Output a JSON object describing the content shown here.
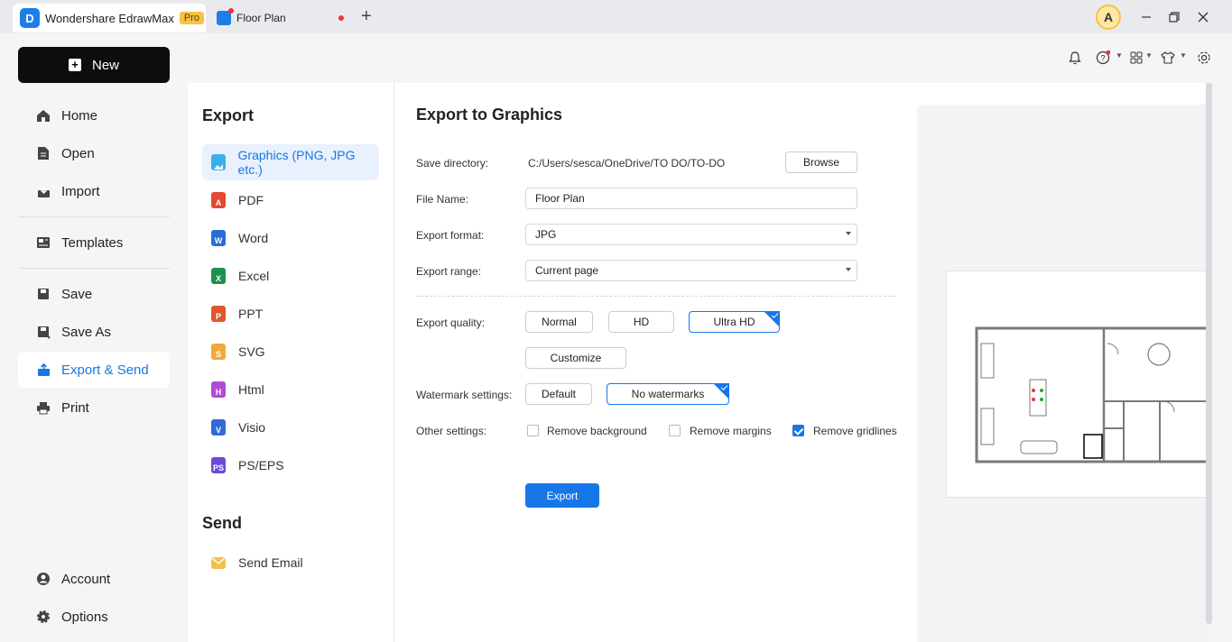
{
  "titlebar": {
    "app_name": "Wondershare EdrawMax",
    "pro_badge": "Pro",
    "doc_tab": "Floor Plan",
    "new_tab": "+",
    "avatar_letter": "A"
  },
  "sidebar": {
    "new_label": "New",
    "items": [
      {
        "label": "Home",
        "icon": "home-icon"
      },
      {
        "label": "Open",
        "icon": "open-icon"
      },
      {
        "label": "Import",
        "icon": "import-icon"
      },
      {
        "label": "Templates",
        "icon": "templates-icon"
      },
      {
        "label": "Save",
        "icon": "save-icon"
      },
      {
        "label": "Save As",
        "icon": "save-as-icon"
      },
      {
        "label": "Export & Send",
        "icon": "export-icon"
      },
      {
        "label": "Print",
        "icon": "print-icon"
      },
      {
        "label": "Account",
        "icon": "account-icon"
      },
      {
        "label": "Options",
        "icon": "options-icon"
      }
    ]
  },
  "export_list": {
    "title": "Export",
    "items": [
      {
        "label": "Graphics (PNG, JPG etc.)",
        "color": "#3ab0e8"
      },
      {
        "label": "PDF",
        "color": "#e5472f"
      },
      {
        "label": "Word",
        "color": "#2b6cd6"
      },
      {
        "label": "Excel",
        "color": "#1f8f4e"
      },
      {
        "label": "PPT",
        "color": "#e0572c"
      },
      {
        "label": "SVG",
        "color": "#f2a93b"
      },
      {
        "label": "Html",
        "color": "#b24ad8"
      },
      {
        "label": "Visio",
        "color": "#3569d6"
      },
      {
        "label": "PS/EPS",
        "color": "#6b4ad8"
      }
    ],
    "send_title": "Send",
    "send_items": [
      {
        "label": "Send Email",
        "color": "#f5c04a"
      }
    ]
  },
  "form": {
    "title": "Export to Graphics",
    "save_directory_label": "Save directory:",
    "save_directory_value": "C:/Users/sesca/OneDrive/TO DO/TO-DO",
    "browse_label": "Browse",
    "file_name_label": "File Name:",
    "file_name_value": "Floor Plan",
    "export_format_label": "Export format:",
    "export_format_value": "JPG",
    "export_range_label": "Export range:",
    "export_range_value": "Current page",
    "quality_label": "Export quality:",
    "quality_options": [
      "Normal",
      "HD",
      "Ultra HD"
    ],
    "quality_selected": "Ultra HD",
    "customize_label": "Customize",
    "watermark_label": "Watermark settings:",
    "watermark_options": [
      "Default",
      "No watermarks"
    ],
    "watermark_selected": "No watermarks",
    "other_label": "Other settings:",
    "other_options": [
      {
        "label": "Remove background",
        "checked": false
      },
      {
        "label": "Remove margins",
        "checked": false
      },
      {
        "label": "Remove gridlines",
        "checked": true
      }
    ],
    "export_button": "Export"
  },
  "colors": {
    "accent": "#1777e8",
    "new_button_bg": "#0d0d0d"
  }
}
